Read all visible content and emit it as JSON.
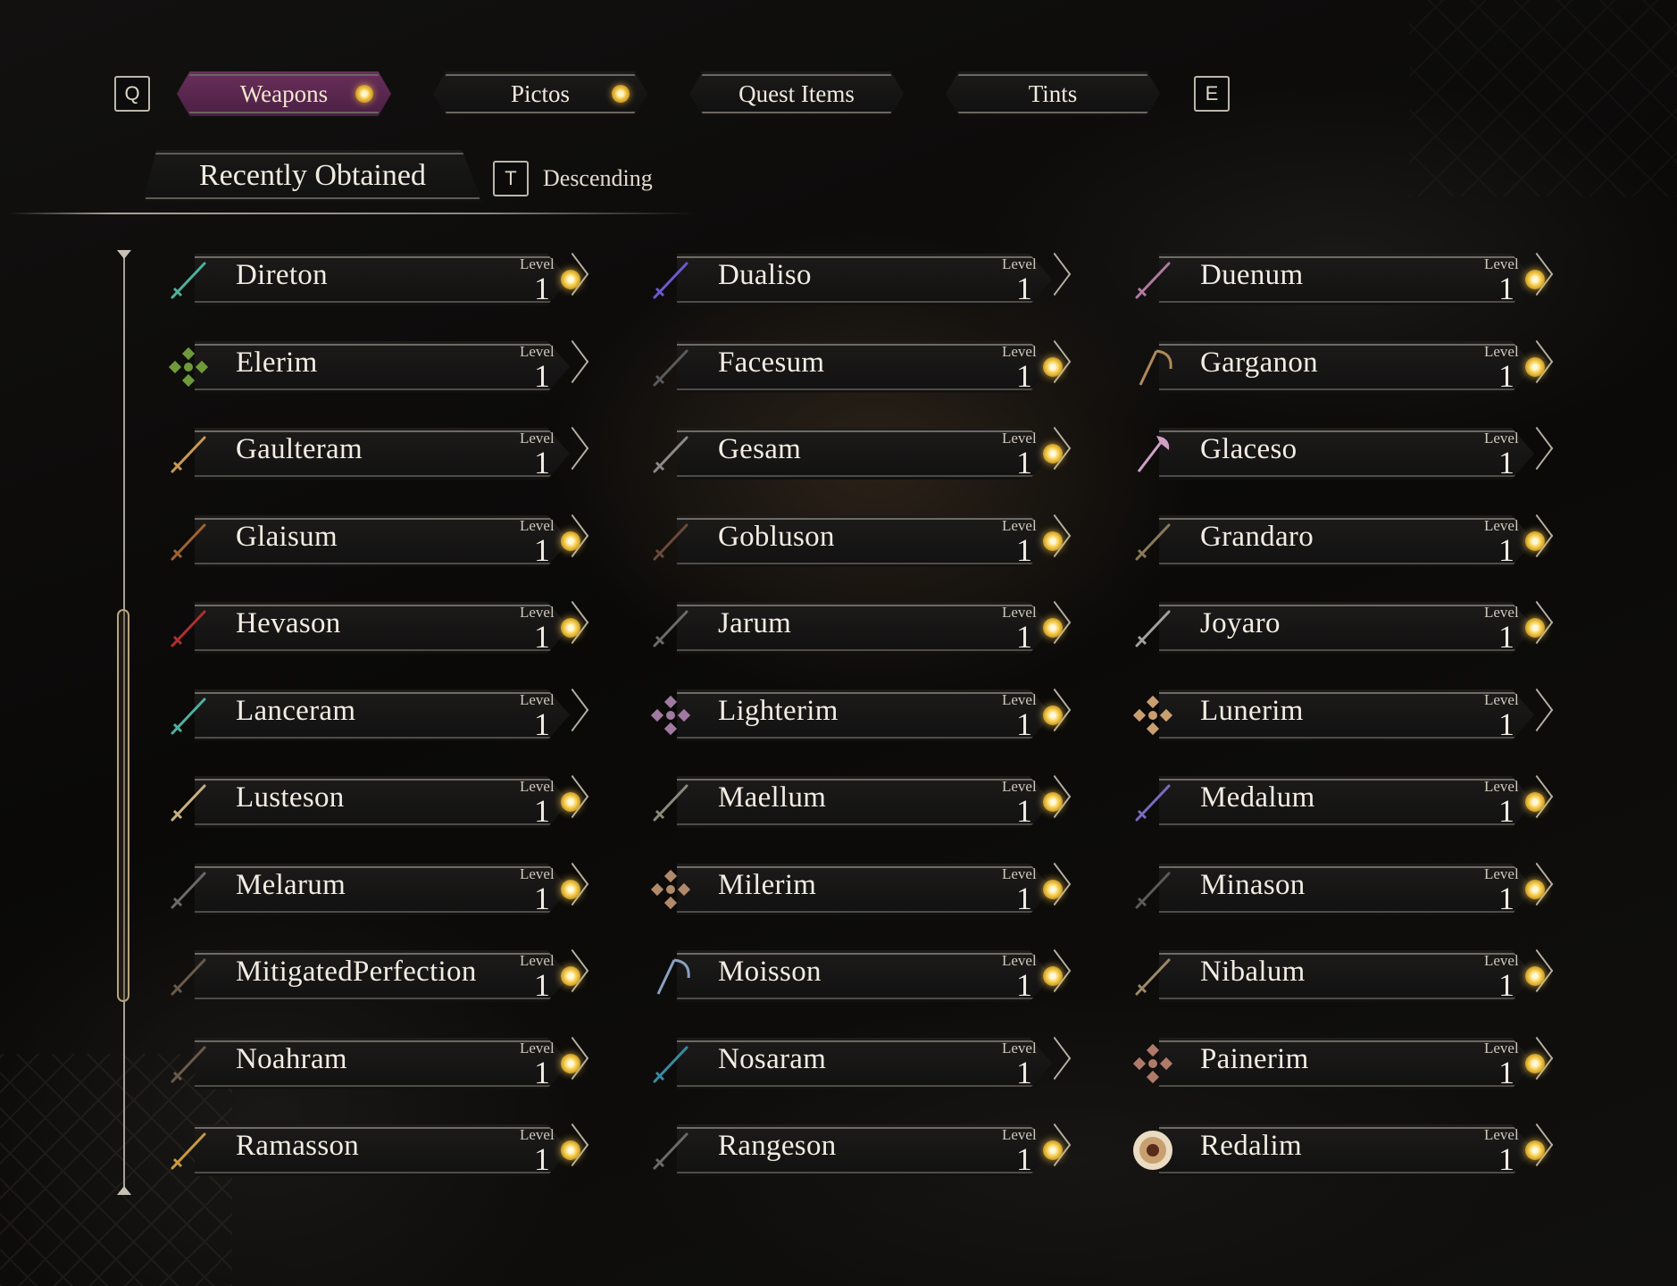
{
  "tabs": {
    "left_key": "Q",
    "right_key": "E",
    "items": [
      {
        "label": "Weapons",
        "active": true,
        "has_new": true
      },
      {
        "label": "Pictos",
        "active": false,
        "has_new": true
      },
      {
        "label": "Quest Items",
        "active": false,
        "has_new": false
      },
      {
        "label": "Tints",
        "active": false,
        "has_new": false
      }
    ]
  },
  "sort": {
    "label": "Recently Obtained",
    "toggle_key": "T",
    "direction": "Descending"
  },
  "level_label": "Level",
  "colors": {
    "active_tab": "#5a2650",
    "new_gem": "#f4c843",
    "panel": "#161514"
  },
  "weapons": [
    {
      "name": "Direton",
      "level": "1",
      "new": true,
      "icon": "sword-icon",
      "icon_color": "#4fb09a"
    },
    {
      "name": "Dualiso",
      "level": "1",
      "new": false,
      "icon": "sword-icon",
      "icon_color": "#6a5acd"
    },
    {
      "name": "Duenum",
      "level": "1",
      "new": true,
      "icon": "sword-icon",
      "icon_color": "#b07aa0"
    },
    {
      "name": "Elerim",
      "level": "1",
      "new": false,
      "icon": "charm-icon",
      "icon_color": "#6f9a3a"
    },
    {
      "name": "Facesum",
      "level": "1",
      "new": true,
      "icon": "sword-icon",
      "icon_color": "#5a5a5a"
    },
    {
      "name": "Garganon",
      "level": "1",
      "new": true,
      "icon": "scythe-icon",
      "icon_color": "#b08a5a"
    },
    {
      "name": "Gaulteram",
      "level": "1",
      "new": false,
      "icon": "sword-icon",
      "icon_color": "#c89a52"
    },
    {
      "name": "Gesam",
      "level": "1",
      "new": true,
      "icon": "sword-icon",
      "icon_color": "#8a8a8a"
    },
    {
      "name": "Glaceso",
      "level": "1",
      "new": false,
      "icon": "axe-icon",
      "icon_color": "#d0a0c8"
    },
    {
      "name": "Glaisum",
      "level": "1",
      "new": true,
      "icon": "sword-icon",
      "icon_color": "#a0622e"
    },
    {
      "name": "Gobluson",
      "level": "1",
      "new": true,
      "icon": "sword-icon",
      "icon_color": "#6a4a3a"
    },
    {
      "name": "Grandaro",
      "level": "1",
      "new": true,
      "icon": "sword-icon",
      "icon_color": "#8a7a5a"
    },
    {
      "name": "Hevason",
      "level": "1",
      "new": true,
      "icon": "sword-icon",
      "icon_color": "#b03030"
    },
    {
      "name": "Jarum",
      "level": "1",
      "new": true,
      "icon": "sword-icon",
      "icon_color": "#6a6a6a"
    },
    {
      "name": "Joyaro",
      "level": "1",
      "new": true,
      "icon": "sword-icon",
      "icon_color": "#a0a0a0"
    },
    {
      "name": "Lanceram",
      "level": "1",
      "new": false,
      "icon": "sword-icon",
      "icon_color": "#4fb0a0"
    },
    {
      "name": "Lighterim",
      "level": "1",
      "new": true,
      "icon": "charm-icon",
      "icon_color": "#a07aa0"
    },
    {
      "name": "Lunerim",
      "level": "1",
      "new": false,
      "icon": "charm-icon",
      "icon_color": "#c8a070"
    },
    {
      "name": "Lusteson",
      "level": "1",
      "new": true,
      "icon": "sword-icon",
      "icon_color": "#c8b080"
    },
    {
      "name": "Maellum",
      "level": "1",
      "new": true,
      "icon": "sword-icon",
      "icon_color": "#8a8a7a"
    },
    {
      "name": "Medalum",
      "level": "1",
      "new": true,
      "icon": "sword-icon",
      "icon_color": "#7a6ac0"
    },
    {
      "name": "Melarum",
      "level": "1",
      "new": true,
      "icon": "sword-icon",
      "icon_color": "#6a6a6a"
    },
    {
      "name": "Milerim",
      "level": "1",
      "new": true,
      "icon": "charm-icon",
      "icon_color": "#b08a6a"
    },
    {
      "name": "Minason",
      "level": "1",
      "new": true,
      "icon": "sword-icon",
      "icon_color": "#5a5a5a"
    },
    {
      "name": "MitigatedPerfection",
      "level": "1",
      "new": true,
      "icon": "sword-icon",
      "icon_color": "#6a5a4a"
    },
    {
      "name": "Moisson",
      "level": "1",
      "new": true,
      "icon": "scythe-icon",
      "icon_color": "#8aa0c0"
    },
    {
      "name": "Nibalum",
      "level": "1",
      "new": true,
      "icon": "sword-icon",
      "icon_color": "#9a8a6a"
    },
    {
      "name": "Noahram",
      "level": "1",
      "new": true,
      "icon": "sword-icon",
      "icon_color": "#6a5a4a"
    },
    {
      "name": "Nosaram",
      "level": "1",
      "new": false,
      "icon": "sword-icon",
      "icon_color": "#3a8aa0"
    },
    {
      "name": "Painerim",
      "level": "1",
      "new": true,
      "icon": "charm-icon",
      "icon_color": "#b07a6a"
    },
    {
      "name": "Ramasson",
      "level": "1",
      "new": true,
      "icon": "sword-icon",
      "icon_color": "#c89a40"
    },
    {
      "name": "Rangeson",
      "level": "1",
      "new": true,
      "icon": "sword-icon",
      "icon_color": "#6a6a6a"
    },
    {
      "name": "Redalim",
      "level": "1",
      "new": true,
      "icon": "medallion-icon",
      "icon_color": "#c8a070"
    }
  ]
}
